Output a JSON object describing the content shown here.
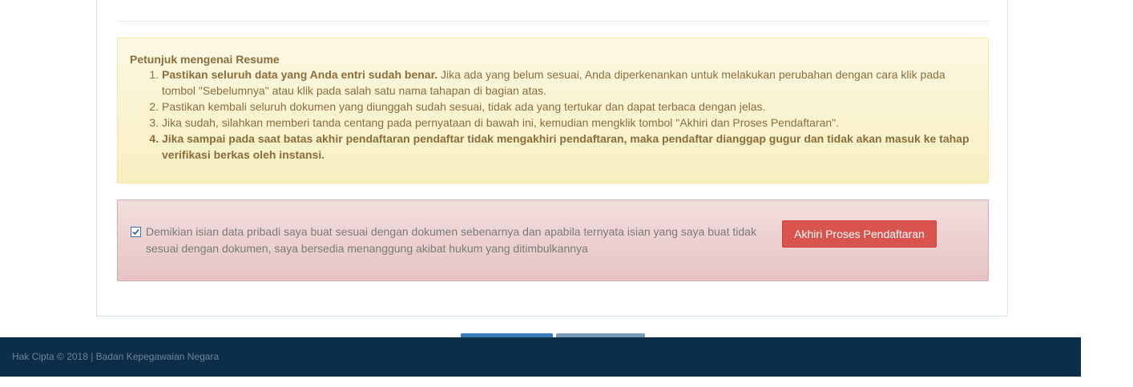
{
  "instructions": {
    "title": "Petunjuk mengenai Resume",
    "items": [
      {
        "bold": "Pastikan seluruh data yang Anda entri sudah benar.",
        "text": " Jika ada yang belum sesuai, Anda diperkenankan untuk melakukan perubahan dengan cara klik pada tombol \"Sebelumnya\" atau klik pada salah satu nama tahapan di bagian atas."
      },
      {
        "text": "Pastikan kembali seluruh dokumen yang diunggah sudah sesuai, tidak ada yang tertukar dan dapat terbaca dengan jelas."
      },
      {
        "text": "Jika sudah, silahkan memberi tanda centang pada pernyataan di bawah ini, kemudian mengklik tombol \"Akhiri dan Proses Pendaftaran\"."
      },
      {
        "text": "Jika sampai pada saat batas akhir pendaftaran pendaftar tidak mengakhiri pendaftaran, maka pendaftar dianggap gugur dan tidak akan masuk ke tahap verifikasi berkas oleh instansi."
      }
    ]
  },
  "statement": {
    "checked": true,
    "check_glyph": "✔",
    "text": "Demikian isian data pribadi saya buat sesuai dengan dokumen sebenarnya dan apabila ternyata isian yang saya buat tidak sesuai dengan dokumen, saya bersedia menanggung akibat hukum yang ditimbulkannya",
    "button_label": "Akhiri Proses Pendaftaran"
  },
  "footer": {
    "copyright": "Hak Cipta © 2018 | Badan Kepegawaian Negara"
  },
  "colors": {
    "warning_text": "#8a6d3b",
    "danger_button": "#d9534f",
    "footer_bg": "#0c2e48",
    "nav_primary": "#337ab7"
  }
}
